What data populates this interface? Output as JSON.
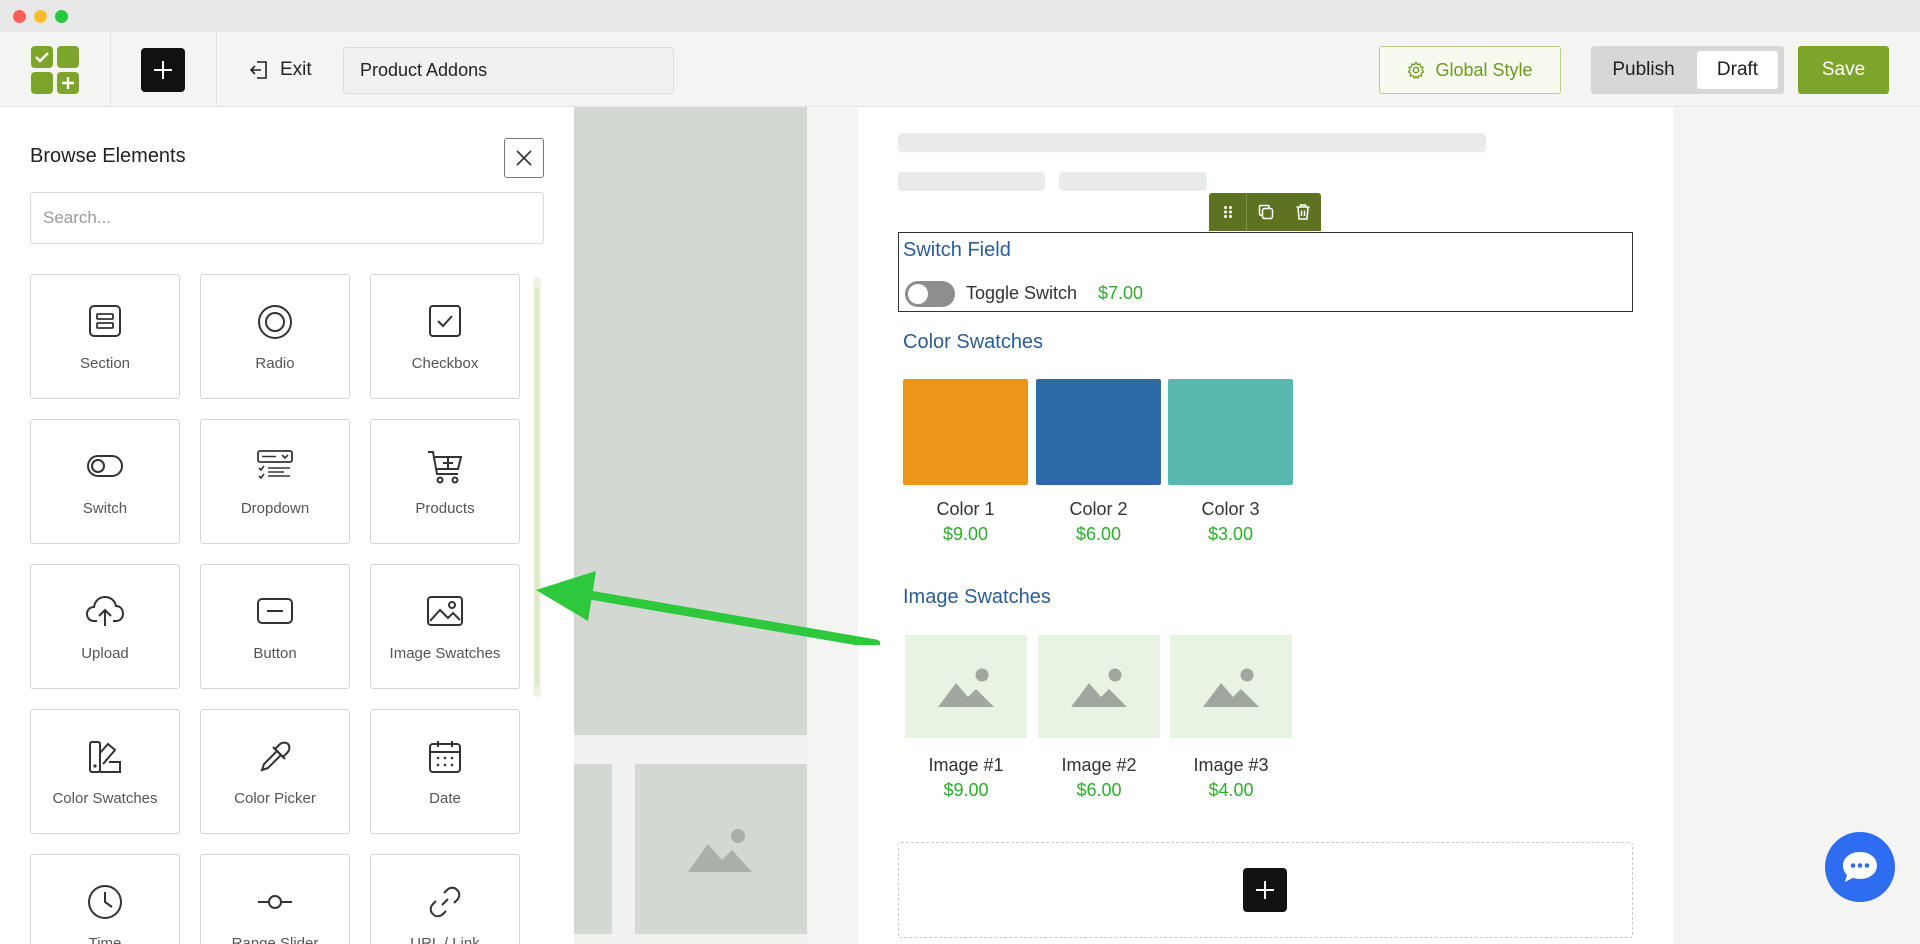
{
  "toolbar": {
    "exit_label": "Exit",
    "title_value": "Product Addons",
    "global_style_label": "Global Style",
    "publish_label": "Publish",
    "draft_label": "Draft",
    "save_label": "Save"
  },
  "panel": {
    "title": "Browse Elements",
    "search_placeholder": "Search...",
    "elements": [
      {
        "label": "Section",
        "icon": "section-icon"
      },
      {
        "label": "Radio",
        "icon": "radio-icon"
      },
      {
        "label": "Checkbox",
        "icon": "checkbox-icon"
      },
      {
        "label": "Switch",
        "icon": "switch-icon"
      },
      {
        "label": "Dropdown",
        "icon": "dropdown-icon"
      },
      {
        "label": "Products",
        "icon": "cart-icon"
      },
      {
        "label": "Upload",
        "icon": "upload-icon"
      },
      {
        "label": "Button",
        "icon": "button-icon"
      },
      {
        "label": "Image Swatches",
        "icon": "image-icon"
      },
      {
        "label": "Color Swatches",
        "icon": "color-swatches-icon"
      },
      {
        "label": "Color Picker",
        "icon": "color-picker-icon"
      },
      {
        "label": "Date",
        "icon": "calendar-icon"
      },
      {
        "label": "Time",
        "icon": "clock-icon"
      },
      {
        "label": "Range Slider",
        "icon": "range-slider-icon"
      },
      {
        "label": "URL / Link",
        "icon": "link-icon"
      }
    ]
  },
  "form": {
    "switch_field": {
      "title": "Switch Field",
      "toggle_label": "Toggle Switch",
      "price": "$7.00"
    },
    "color_swatches": {
      "title": "Color Swatches",
      "items": [
        {
          "name": "Color 1",
          "price": "$9.00",
          "color": "#ec9519"
        },
        {
          "name": "Color 2",
          "price": "$6.00",
          "color": "#2d6aa6"
        },
        {
          "name": "Color 3",
          "price": "$3.00",
          "color": "#58b8b0"
        }
      ]
    },
    "image_swatches": {
      "title": "Image Swatches",
      "items": [
        {
          "name": "Image #1",
          "price": "$9.00"
        },
        {
          "name": "Image #2",
          "price": "$6.00"
        },
        {
          "name": "Image #3",
          "price": "$4.00"
        }
      ]
    }
  },
  "colors": {
    "accent": "#7da52c",
    "heading_blue": "#2a5c99",
    "price_green": "#2cae2c",
    "arrow_green": "#2ec83c",
    "chat_blue": "#2f6df0"
  }
}
